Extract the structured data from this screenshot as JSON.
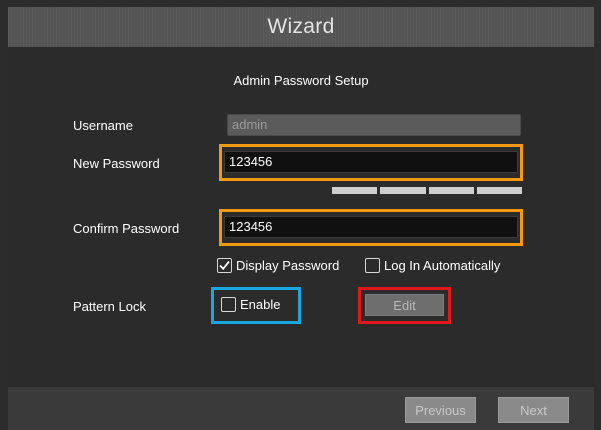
{
  "window": {
    "title": "Wizard"
  },
  "page": {
    "heading": "Admin Password Setup"
  },
  "form": {
    "username": {
      "label": "Username",
      "value": "admin"
    },
    "new_password": {
      "label": "New Password",
      "value": "123456"
    },
    "confirm_password": {
      "label": "Confirm Password",
      "value": "123456"
    },
    "strength_meter": {
      "segments": 4
    },
    "display_password": {
      "label": "Display Password",
      "checked": true
    },
    "log_in_automatically": {
      "label": "Log In Automatically",
      "checked": false
    },
    "pattern_lock": {
      "label": "Pattern Lock",
      "enable_label": "Enable",
      "enabled": false,
      "edit_label": "Edit"
    }
  },
  "footer": {
    "previous_label": "Previous",
    "next_label": "Next"
  },
  "colors": {
    "highlight_orange": "#f39a10",
    "highlight_blue": "#19a7e0",
    "highlight_red": "#e3161c"
  }
}
